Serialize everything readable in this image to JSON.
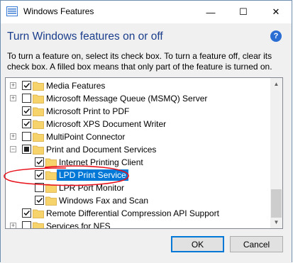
{
  "window": {
    "title": "Windows Features",
    "controls": {
      "minimize": "—",
      "maximize": "☐",
      "close": "✕"
    }
  },
  "heading": "Turn Windows features on or off",
  "help": "?",
  "description": "To turn a feature on, select its check box. To turn a feature off, clear its check box. A filled box means that only part of the feature is turned on.",
  "features": [
    {
      "label": "Media Features",
      "state": "checked",
      "expandable": "plus",
      "level": 0
    },
    {
      "label": "Microsoft Message Queue (MSMQ) Server",
      "state": "unchecked",
      "expandable": "plus",
      "level": 0
    },
    {
      "label": "Microsoft Print to PDF",
      "state": "checked",
      "expandable": "none",
      "level": 0
    },
    {
      "label": "Microsoft XPS Document Writer",
      "state": "checked",
      "expandable": "none",
      "level": 0
    },
    {
      "label": "MultiPoint Connector",
      "state": "unchecked",
      "expandable": "plus",
      "level": 0
    },
    {
      "label": "Print and Document Services",
      "state": "partial",
      "expandable": "minus",
      "level": 0
    },
    {
      "label": "Internet Printing Client",
      "state": "checked",
      "expandable": "none",
      "level": 1
    },
    {
      "label": "LPD Print Service",
      "state": "checked",
      "expandable": "none",
      "level": 1,
      "selected": true
    },
    {
      "label": "LPR Port Monitor",
      "state": "unchecked",
      "expandable": "none",
      "level": 1
    },
    {
      "label": "Windows Fax and Scan",
      "state": "checked",
      "expandable": "none",
      "level": 1
    },
    {
      "label": "Remote Differential Compression API Support",
      "state": "checked",
      "expandable": "none",
      "level": 0
    },
    {
      "label": "Services for NFS",
      "state": "unchecked",
      "expandable": "plus",
      "level": 0
    }
  ],
  "buttons": {
    "ok": "OK",
    "cancel": "Cancel"
  },
  "colors": {
    "accent": "#0078d7",
    "heading": "#1a3e8c",
    "folder": "#f7d36b",
    "annotation": "#e8101a"
  }
}
